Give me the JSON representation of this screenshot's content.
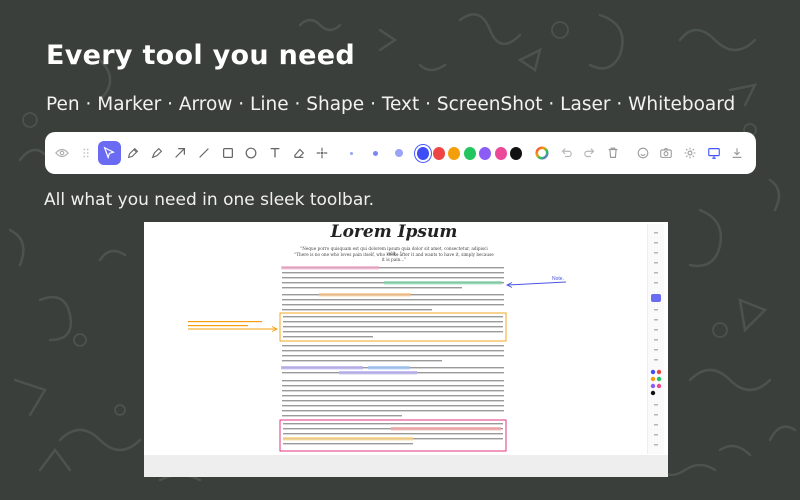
{
  "headline": "Every tool you need",
  "tools_line": "Pen · Marker · Arrow · Line · Shape · Text · ScreenShot · Laser · Whiteboard",
  "subline": "All what you need in one sleek toolbar.",
  "toolbar": {
    "colors": [
      "#3d4cf5",
      "#ef4444",
      "#f59e0b",
      "#22c55e",
      "#8b5cf6",
      "#ec4899",
      "#111111"
    ],
    "selected_color": "#3d4cf5",
    "active_tool": "select",
    "icons": [
      "eye-icon",
      "drag-handle-icon",
      "select-icon",
      "pen-icon",
      "marker-icon",
      "arrow-icon",
      "line-icon",
      "rectangle-icon",
      "circle-icon",
      "text-icon",
      "eraser-icon",
      "laser-icon",
      "small-size-dot",
      "medium-size-dot",
      "large-size-dot",
      "color-wheel-icon",
      "undo-icon",
      "redo-icon",
      "trash-icon",
      "emoji-icon",
      "screenshot-icon",
      "settings-icon",
      "whiteboard-icon",
      "download-icon"
    ]
  },
  "document": {
    "title": "Lorem Ipsum",
    "quote_1": "\"Neque porro quisquam est qui dolorem ipsum quia dolor sit amet, consectetur, adipisci velit...\"",
    "quote_2": "\"There is no one who loves pain itself, who seeks after it and wants to have it, simply because it is pain...\"",
    "note_label": "Note."
  }
}
